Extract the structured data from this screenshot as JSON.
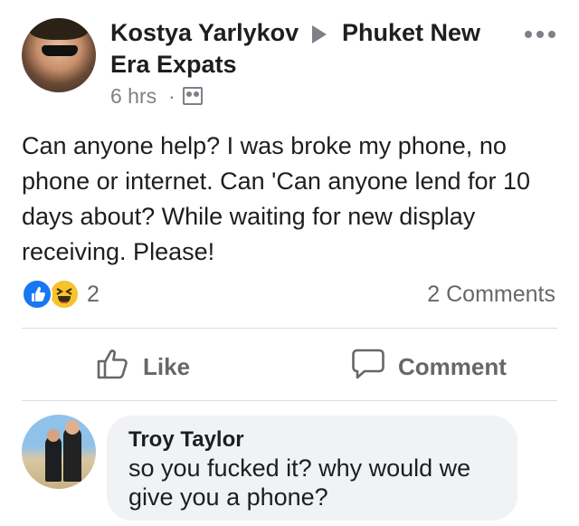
{
  "post": {
    "author": "Kostya Yarlykov",
    "group_line1": "Phuket New",
    "group_line2": "Era Expats",
    "timestamp": "6 hrs",
    "separator": "·",
    "audience_icon": "group-icon",
    "text": "Can anyone help? I was broke my phone, no phone or internet. Can 'Can anyone lend for 10 days about? While waiting for new display receiving. Please!"
  },
  "reactions": {
    "icons": [
      "like-reaction-icon",
      "haha-reaction-icon"
    ],
    "count": "2",
    "comments": "2 Comments"
  },
  "actions": {
    "like_label": "Like",
    "comment_label": "Comment"
  },
  "comment": {
    "author": "Troy Taylor",
    "text": "so you fucked it? why would we give you a phone?"
  },
  "colors": {
    "like_blue": "#1877f2",
    "haha_yellow": "#f7c32b",
    "secondary_text": "#65676b",
    "bubble_bg": "#f0f2f5"
  }
}
